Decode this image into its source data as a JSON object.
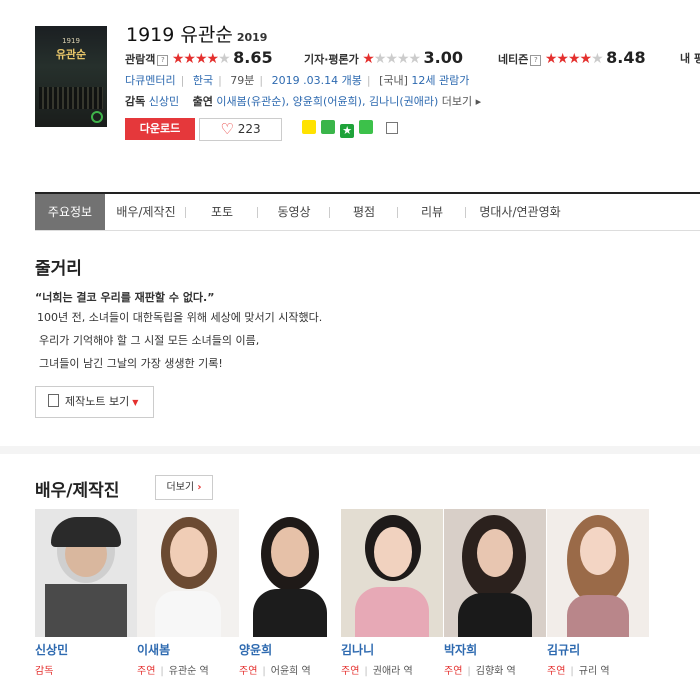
{
  "movie": {
    "title": "1919 유관순",
    "year": "2019",
    "poster_title": "유관순",
    "poster_year": "1919"
  },
  "ratings": {
    "audience": {
      "label": "관람객",
      "score": "8.65",
      "stars": 4.5
    },
    "critic": {
      "label": "기자·평론가",
      "score": "3.00",
      "stars": 1.5
    },
    "netizen": {
      "label": "네티즌",
      "score": "8.48",
      "stars": 4.5
    },
    "my": {
      "label": "내 평"
    }
  },
  "info": {
    "genre": "다큐멘터리",
    "country": "한국",
    "runtime": "79분",
    "release": "2019 .03.14 개봉",
    "rating_prefix": "[국내]",
    "rating": "12세 관람가",
    "director_label": "감독",
    "director": "신상민",
    "cast_label": "출연",
    "cast_text": "이새봄(유관순), 양윤희(어윤희), 김나니(권애라)",
    "more_link": "더보기"
  },
  "actions": {
    "download": "다운로드",
    "like_count": "223"
  },
  "tabs": [
    "주요정보",
    "배우/제작진",
    "포토",
    "동영상",
    "평점",
    "리뷰",
    "명대사/연관영화"
  ],
  "synopsis": {
    "heading": "줄거리",
    "quote": "“너희는 결코 우리를 재판할 수 없다.”",
    "lines": [
      "100년 전, 소녀들이 대한독립을 위해 세상에 맞서기 시작했다.",
      "우리가 기억해야 할 그 시절 모든 소녀들의 이름,",
      "그녀들이 남긴 그날의 가장 생생한 기록!"
    ],
    "note_button": "제작노트 보기"
  },
  "cast_section": {
    "heading": "배우/제작진",
    "more": "더보기",
    "people": [
      {
        "name": "신상민",
        "role": "감독",
        "character": ""
      },
      {
        "name": "이새봄",
        "role": "주연",
        "character": "유관순 역"
      },
      {
        "name": "양윤희",
        "role": "주연",
        "character": "어윤희 역"
      },
      {
        "name": "김나니",
        "role": "주연",
        "character": "권애라 역"
      },
      {
        "name": "박자희",
        "role": "주연",
        "character": "김향화 역"
      },
      {
        "name": "김규리",
        "role": "주연",
        "character": "규리 역"
      }
    ]
  }
}
